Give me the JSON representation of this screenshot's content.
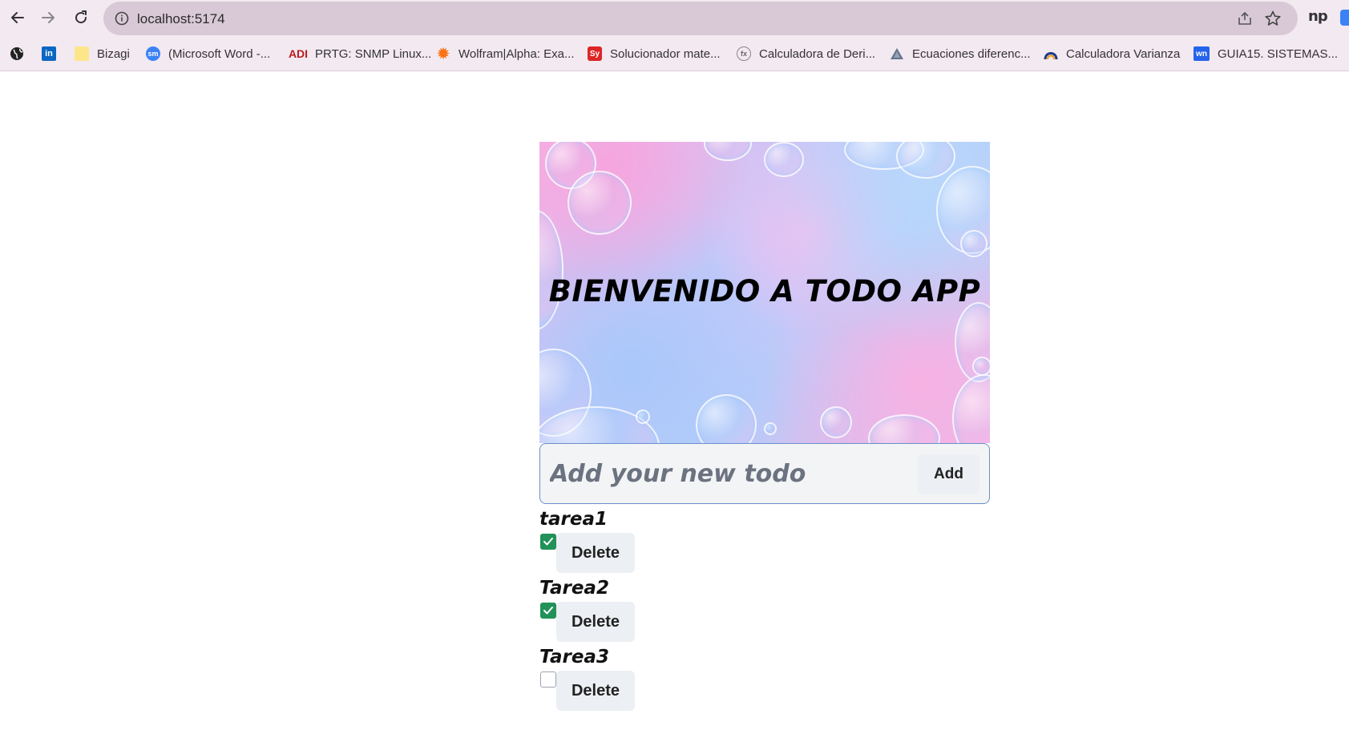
{
  "browser": {
    "url": "localhost:5174",
    "bookmarks": [
      {
        "label": "",
        "icon": "globe-icon"
      },
      {
        "label": "",
        "icon": "linkedin-icon"
      },
      {
        "label": "Bizagi",
        "icon": "folder-icon"
      },
      {
        "label": "(Microsoft Word -...",
        "icon": "sm-icon"
      },
      {
        "label": "PRTG: SNMP Linux...",
        "icon": "adi-icon"
      },
      {
        "label": "Wolfram|Alpha: Exa...",
        "icon": "wolfram-icon"
      },
      {
        "label": "Solucionador mate...",
        "icon": "symbolab-icon"
      },
      {
        "label": "Calculadora de Deri...",
        "icon": "derivative-icon"
      },
      {
        "label": "Ecuaciones diferenc...",
        "icon": "triangle-icon"
      },
      {
        "label": "Calculadora Varianza",
        "icon": "arch-icon"
      },
      {
        "label": "GUIA15. SISTEMAS...",
        "icon": "wn-icon"
      }
    ],
    "extension": "np"
  },
  "hero": {
    "title": "BIENVENIDO A TODO APP"
  },
  "form": {
    "placeholder": "Add your new todo",
    "add_label": "Add"
  },
  "todos": [
    {
      "label": "tarea1",
      "done": true,
      "delete_label": "Delete"
    },
    {
      "label": "Tarea2",
      "done": true,
      "delete_label": "Delete"
    },
    {
      "label": "Tarea3",
      "done": false,
      "delete_label": "Delete"
    }
  ],
  "colors": {
    "checked": "#22915a",
    "form_border": "#6b8fc9",
    "chrome_bg": "#f3e9f1",
    "omnibox_bg": "#d9c9d6"
  }
}
